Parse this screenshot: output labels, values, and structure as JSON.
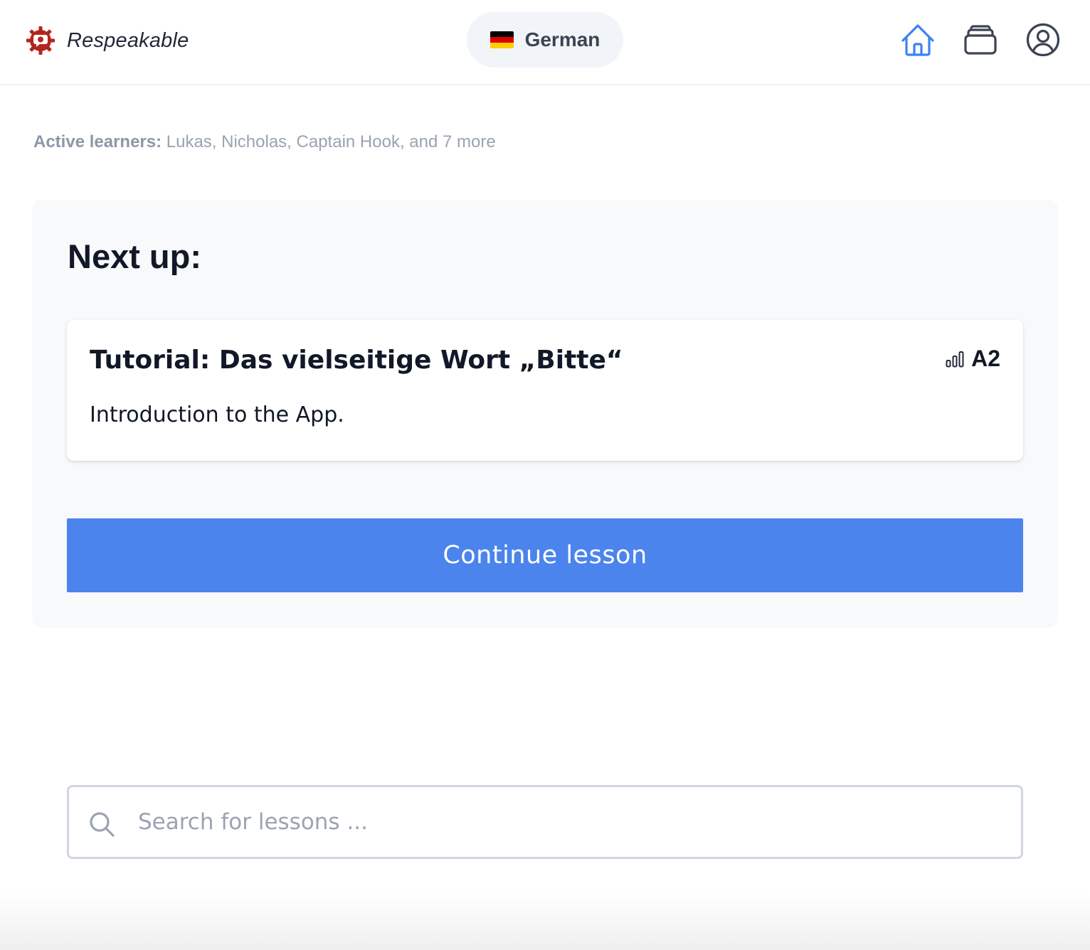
{
  "brand": {
    "name": "Respeakable",
    "logo_icon": "gear-speech-bubble-icon",
    "logo_color": "#b3261e"
  },
  "language": {
    "label": "German",
    "flag_icon": "germany-flag-icon",
    "flag_colors": [
      "#000000",
      "#dd0000",
      "#ffce00"
    ]
  },
  "nav": {
    "home_icon": "home-icon",
    "cards_icon": "card-stack-icon",
    "profile_icon": "user-circle-icon",
    "active_color": "#3b82f6"
  },
  "learners": {
    "label": "Active learners:",
    "names": "Lukas, Nicholas, Captain Hook, and 7 more"
  },
  "next_up": {
    "heading": "Next up:",
    "lesson": {
      "title": "Tutorial: Das vielseitige Wort „Bitte“",
      "description": "Introduction to the App.",
      "level": "A2",
      "level_icon": "signal-bars-icon"
    },
    "continue_label": "Continue lesson",
    "button_color": "#4b84ec"
  },
  "search": {
    "placeholder": "Search for lessons ...",
    "value": ""
  }
}
